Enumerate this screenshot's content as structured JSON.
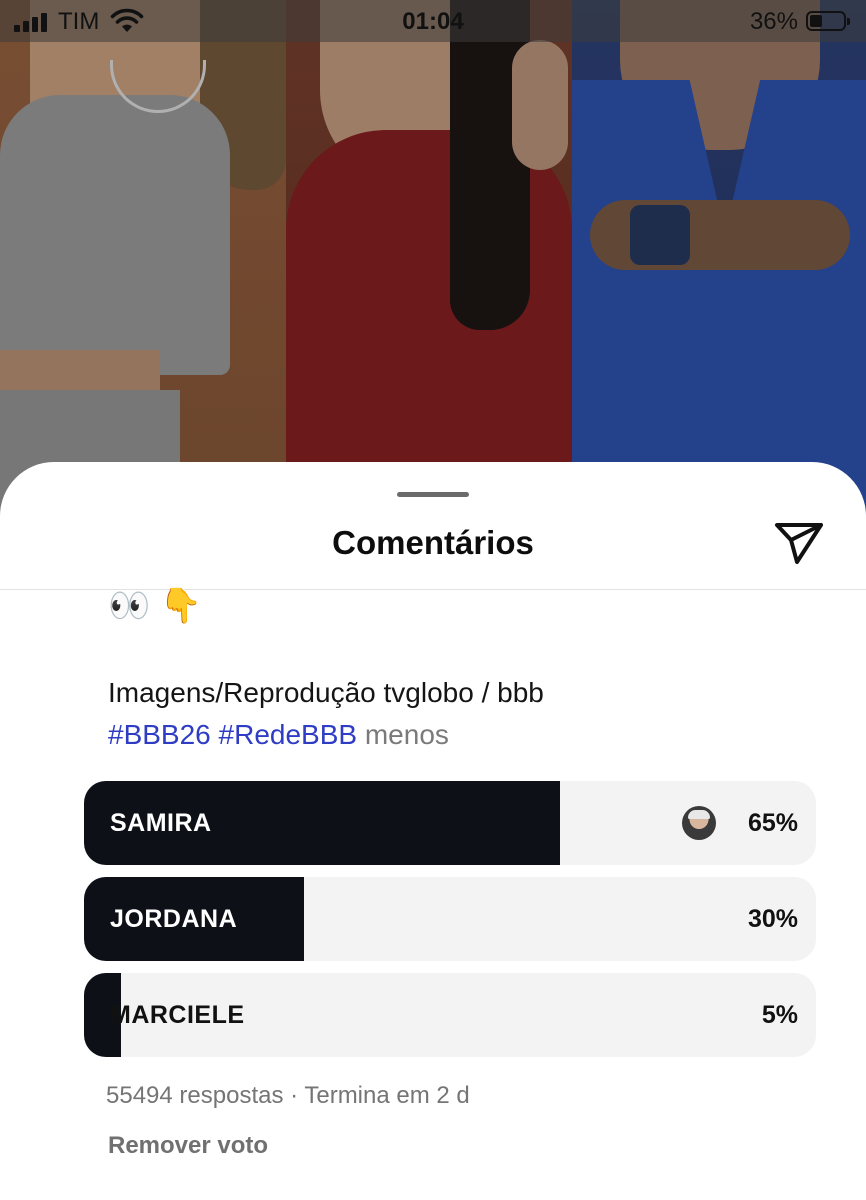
{
  "status_bar": {
    "carrier": "TIM",
    "time": "01:04",
    "battery_percent": "36%",
    "battery_level": 0.36
  },
  "sheet": {
    "title": "Comentários"
  },
  "post": {
    "emojis": "👀 👇",
    "caption": "Imagens/Reprodução tvglobo / bbb",
    "hashtags": [
      "#BBB26",
      "#RedeBBB"
    ],
    "less_label": "menos"
  },
  "poll": {
    "options": [
      {
        "label": "SAMIRA",
        "percent": "65%",
        "value": 65,
        "voted": true
      },
      {
        "label": "JORDANA",
        "percent": "30%",
        "value": 30,
        "voted": false
      },
      {
        "label": "MARCIELE",
        "percent": "5%",
        "value": 5,
        "voted": false
      }
    ],
    "meta": "55494 respostas · Termina em 2 d",
    "remove_vote_label": "Remover voto"
  },
  "colors": {
    "poll_fill": "#0d1117",
    "poll_track": "#f3f3f3",
    "hashtag": "#2f3dc4"
  }
}
